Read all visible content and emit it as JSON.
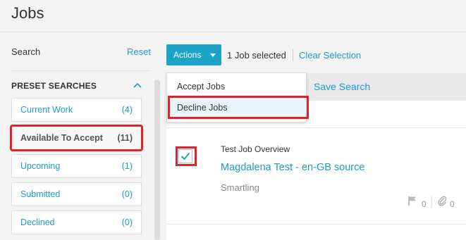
{
  "page": {
    "title": "Jobs"
  },
  "sidebar": {
    "search_label": "Search",
    "reset_label": "Reset",
    "preset_heading": "PRESET SEARCHES",
    "items": [
      {
        "label": "Current Work",
        "count": "(4)"
      },
      {
        "label": "Available To Accept",
        "count": "(11)"
      },
      {
        "label": "Upcoming",
        "count": "(1)"
      },
      {
        "label": "Submitted",
        "count": "(0)"
      },
      {
        "label": "Declined",
        "count": "(0)"
      }
    ]
  },
  "toolbar": {
    "actions_label": "Actions",
    "selected_text": "1 Job selected",
    "clear_selection": "Clear Selection",
    "save_search": "Save Search"
  },
  "dropdown": {
    "items": [
      {
        "label": "Accept Jobs"
      },
      {
        "label": "Decline Jobs"
      }
    ]
  },
  "job": {
    "label": "Test Job Overview",
    "name": "Magdalena Test - en-GB source",
    "company": "Smartling",
    "flag_count": "0",
    "attachment_count": "0",
    "checked": true
  },
  "colors": {
    "accent": "#1ba4c7",
    "link": "#1d9ad1",
    "highlight": "#d9262e"
  }
}
